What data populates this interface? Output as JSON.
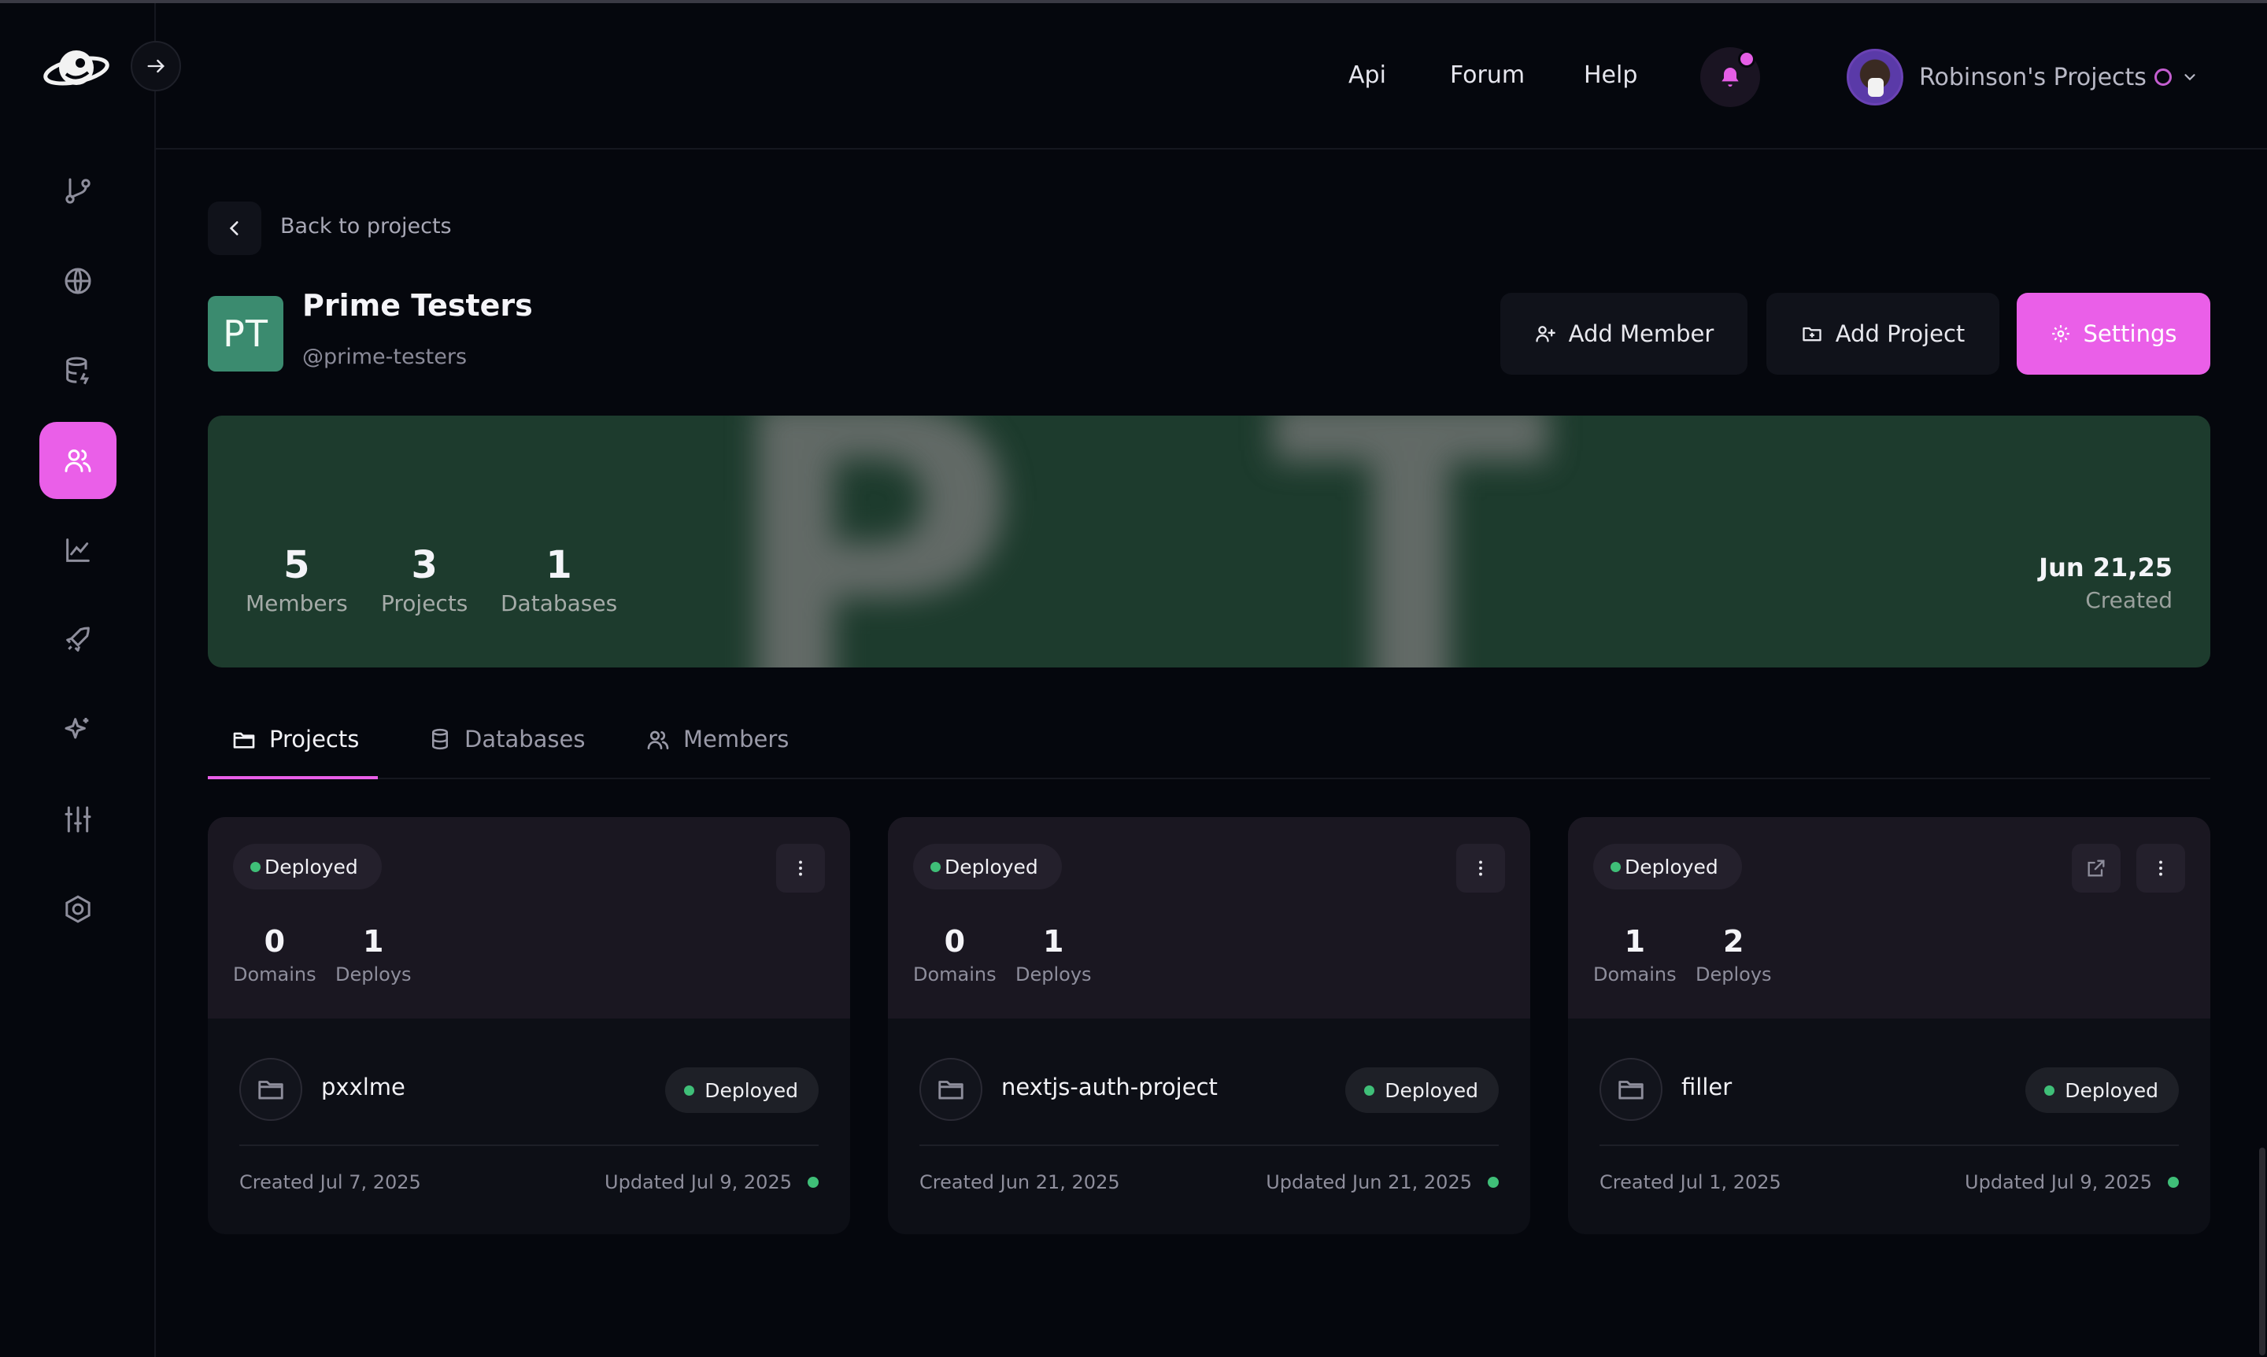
{
  "header": {
    "links": [
      "Api",
      "Forum",
      "Help"
    ],
    "user_name": "Robinson's Projects"
  },
  "breadcrumb": {
    "back_label": "Back to projects"
  },
  "org": {
    "initials": "PT",
    "name": "Prime Testers",
    "handle": "@prime-testers",
    "logo_color": "#3b8b6f"
  },
  "actions": {
    "add_member": "Add Member",
    "add_project": "Add Project",
    "settings": "Settings"
  },
  "banner": {
    "stats": [
      {
        "value": "5",
        "label": "Members"
      },
      {
        "value": "3",
        "label": "Projects"
      },
      {
        "value": "1",
        "label": "Databases"
      }
    ],
    "created_date": "Jun 21,25",
    "created_label": "Created"
  },
  "tabs": [
    {
      "label": "Projects",
      "active": true,
      "icon": "folder-icon"
    },
    {
      "label": "Databases",
      "active": false,
      "icon": "database-icon"
    },
    {
      "label": "Members",
      "active": false,
      "icon": "users-icon"
    }
  ],
  "projects": [
    {
      "status": "Deployed",
      "domains": "0",
      "domains_label": "Domains",
      "deploys": "1",
      "deploys_label": "Deploys",
      "name": "pxxlme",
      "created": "Created Jul 7, 2025",
      "updated": "Updated Jul 9, 2025"
    },
    {
      "status": "Deployed",
      "domains": "0",
      "domains_label": "Domains",
      "deploys": "1",
      "deploys_label": "Deploys",
      "name": "nextjs-auth-project",
      "created": "Created Jun 21, 2025",
      "updated": "Updated Jun 21, 2025"
    },
    {
      "status": "Deployed",
      "domains": "1",
      "domains_label": "Domains",
      "deploys": "2",
      "deploys_label": "Deploys",
      "name": "filler",
      "created": "Created Jul 1, 2025",
      "updated": "Updated Jul 9, 2025"
    }
  ],
  "colors": {
    "accent": "#ea5fe8",
    "background": "#05070d",
    "banner": "#1d3b2d",
    "status_ok": "#3fbf78"
  }
}
